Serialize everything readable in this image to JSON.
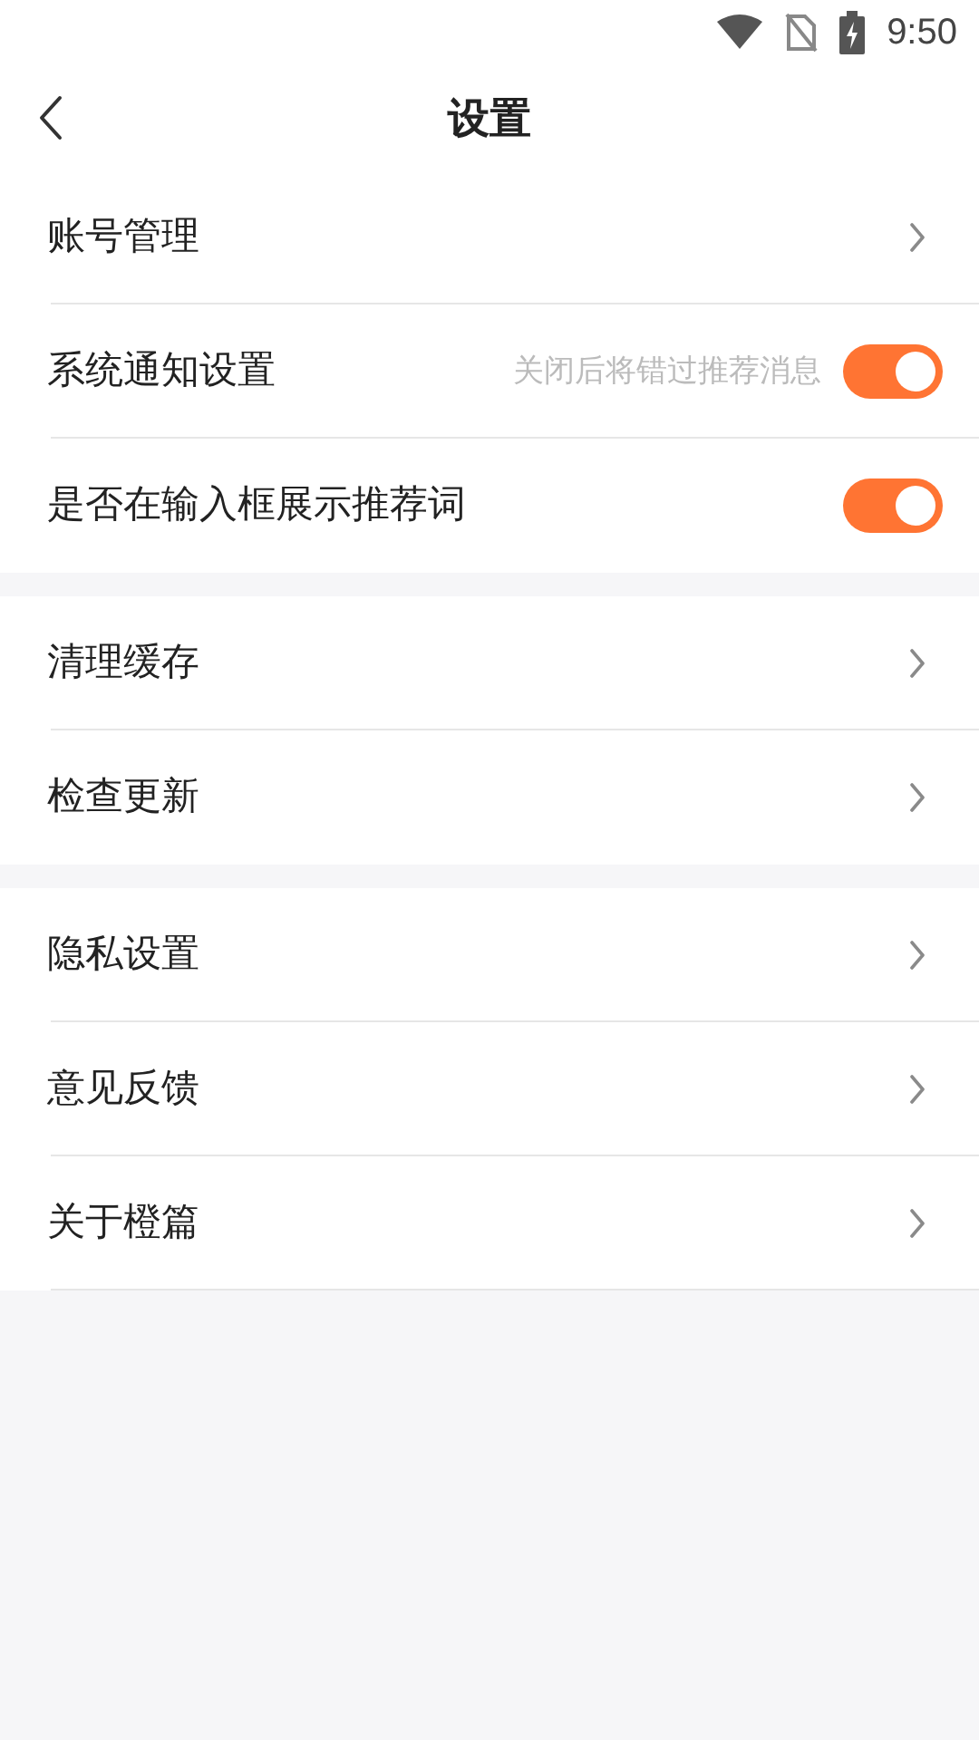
{
  "status_bar": {
    "time": "9:50"
  },
  "header": {
    "title": "设置"
  },
  "groups": [
    {
      "items": [
        {
          "kind": "link",
          "label": "账号管理"
        },
        {
          "kind": "toggle",
          "label": "系统通知设置",
          "hint": "关闭后将错过推荐消息",
          "on": true
        },
        {
          "kind": "toggle",
          "label": "是否在输入框展示推荐词",
          "on": true
        }
      ]
    },
    {
      "items": [
        {
          "kind": "link",
          "label": "清理缓存"
        },
        {
          "kind": "link",
          "label": "检查更新"
        }
      ]
    },
    {
      "items": [
        {
          "kind": "link",
          "label": "隐私设置"
        },
        {
          "kind": "link",
          "label": "意见反馈"
        },
        {
          "kind": "link",
          "label": "关于橙篇"
        }
      ]
    }
  ]
}
